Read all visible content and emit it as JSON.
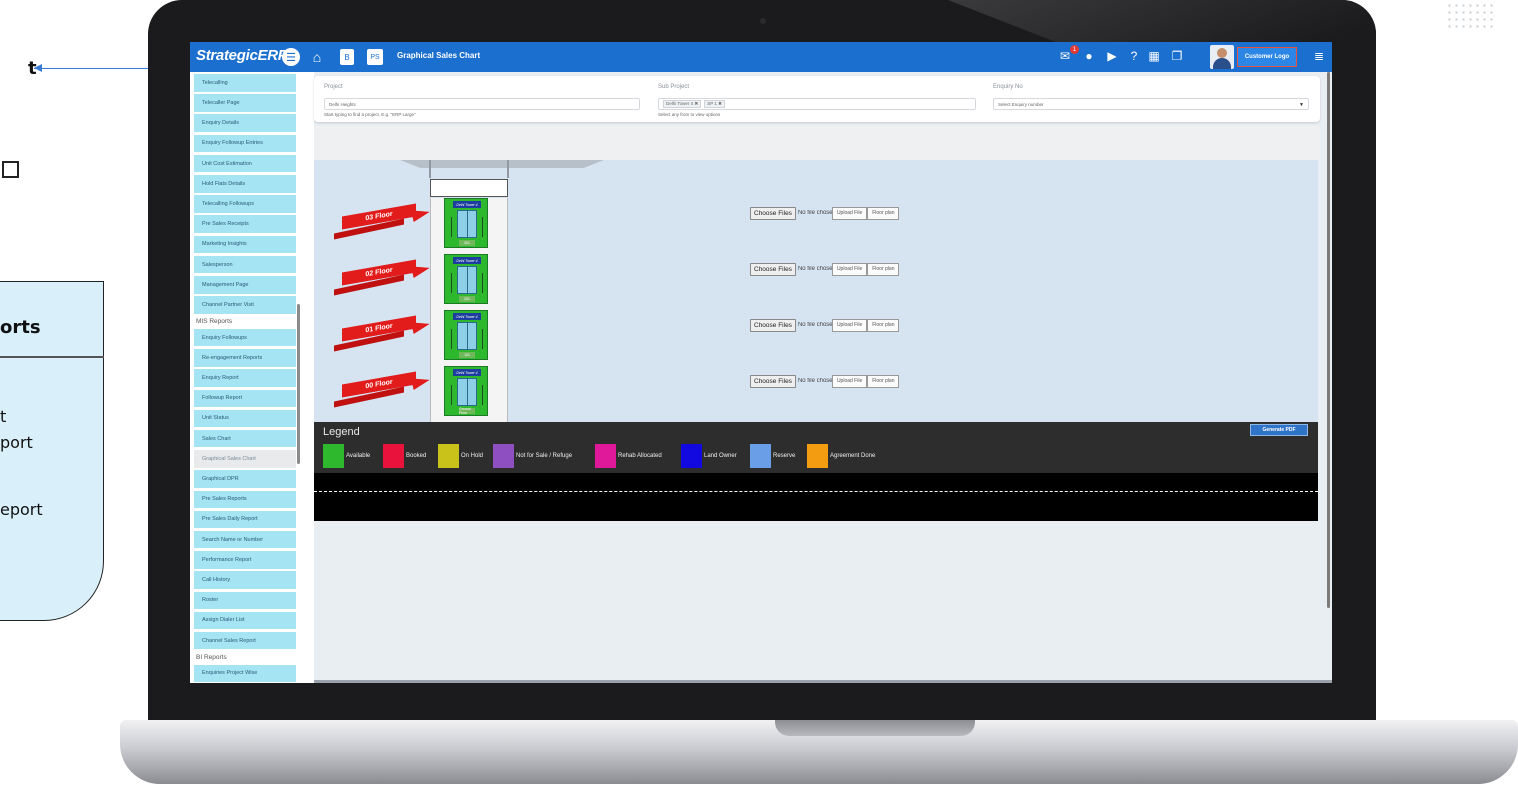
{
  "left_fragment": {
    "bold_text": "t",
    "card_title": "orts",
    "lines": [
      "t",
      "port",
      "eport"
    ]
  },
  "app": {
    "brand": "StrategicERP",
    "page_title": "Graphical Sales Chart",
    "icons": [
      "menu-icon",
      "home-icon",
      "b-icon",
      "ps-icon",
      "mail-icon",
      "mic-icon",
      "video-icon",
      "help-icon",
      "calculator-icon",
      "copy-icon",
      "list-icon"
    ],
    "icon_labels": {
      "b": "B",
      "ps": "PS"
    },
    "mail_badge": "1",
    "customer_logo": "Customer Logo",
    "accent": "#1a6fcf"
  },
  "sidebar": {
    "items": [
      {
        "label": "Telecalling"
      },
      {
        "label": "Telecaller Page"
      },
      {
        "label": "Enquiry Details"
      },
      {
        "label": "Enquiry Followup Entries"
      },
      {
        "label": "Unit Cost Estimation"
      },
      {
        "label": "Hold Flats Details"
      },
      {
        "label": "Telecalling Followups"
      },
      {
        "label": "Pre Sales Receipts"
      },
      {
        "label": "Marketing Insights"
      },
      {
        "label": "Salesperson"
      },
      {
        "label": "Management Page"
      },
      {
        "label": "Channel Partner Visit"
      }
    ],
    "mis_header": "MIS Reports",
    "mis_items": [
      {
        "label": "Enquiry Followups"
      },
      {
        "label": "Re-engagement Reports"
      },
      {
        "label": "Enquiry Report"
      },
      {
        "label": "Followup Report"
      },
      {
        "label": "Unit Status"
      },
      {
        "label": "Sales Chart"
      },
      {
        "label": "Graphical Sales Chart"
      },
      {
        "label": "Graphical DPR"
      },
      {
        "label": "Pre Sales Reports"
      },
      {
        "label": "Pre Sales Daily Report"
      },
      {
        "label": "Search Name or Number"
      },
      {
        "label": "Performance Report"
      },
      {
        "label": "Call History"
      },
      {
        "label": "Roster"
      },
      {
        "label": "Assign Dialer List"
      },
      {
        "label": "Channel Sales Report"
      }
    ],
    "bi_header": "BI Reports",
    "bi_items": [
      {
        "label": "Enquiries Project Wise"
      }
    ]
  },
  "filters": {
    "project": {
      "label": "Project",
      "value": "Delhi Heights",
      "hint": "Start typing to find a project. E.g. \"ERP Large\""
    },
    "subproject": {
      "label": "Sub Project",
      "chips": [
        "Delhi Tower 4",
        "SP 1"
      ],
      "hint": "Select any from to view options"
    },
    "enquiry": {
      "label": "Enquiry No",
      "placeholder": "Select Enquiry number"
    }
  },
  "floors": [
    {
      "label": "03 Floor",
      "unit_name": "Delhi Tower 4",
      "unit_no": "301",
      "status": "Available"
    },
    {
      "label": "02 Floor",
      "unit_name": "Delhi Tower 4",
      "unit_no": "201",
      "status": "Available"
    },
    {
      "label": "01 Floor",
      "unit_name": "Delhi Tower 4",
      "unit_no": "101",
      "status": "Available"
    },
    {
      "label": "00 Floor",
      "unit_name": "Delhi Tower 4",
      "unit_no": "Ground Floor",
      "status": "Available"
    }
  ],
  "upload": {
    "choose": "Choose Files",
    "nofile": "No file chosen",
    "upload_btn": "Upload File",
    "floor_plan_btn": "Floor plan"
  },
  "legend": {
    "title": "Legend",
    "generate_pdf": "Generate PDF",
    "items": [
      {
        "label": "Available",
        "color": "#2db82d"
      },
      {
        "label": "Booked",
        "color": "#e8123c"
      },
      {
        "label": "On Hold",
        "color": "#c8c21a"
      },
      {
        "label": "Not for Sale / Refuge",
        "color": "#8e4fc0"
      },
      {
        "label": "Rehab Allocated",
        "color": "#e0189a"
      },
      {
        "label": "Land Owner",
        "color": "#1209e0"
      },
      {
        "label": "Reserve",
        "color": "#6a9ee6"
      },
      {
        "label": "Agreement Done",
        "color": "#f39c12"
      }
    ]
  }
}
